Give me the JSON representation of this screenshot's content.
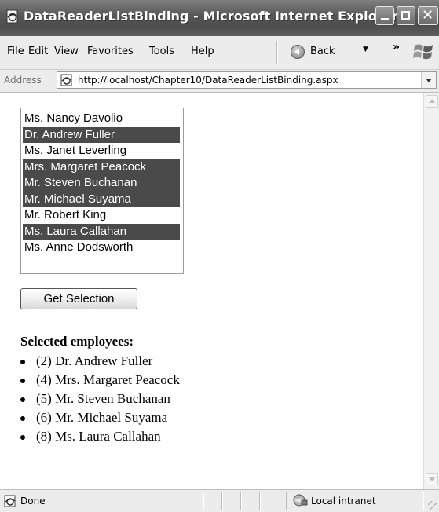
{
  "window": {
    "title": "DataReaderListBinding - Microsoft Internet Explorer"
  },
  "menu": {
    "items": [
      "File",
      "Edit",
      "View",
      "Favorites",
      "Tools",
      "Help"
    ],
    "back_label": "Back",
    "overflow": "»"
  },
  "address": {
    "label": "Address",
    "url": "http://localhost/Chapter10/DataReaderListBinding.aspx"
  },
  "listbox": {
    "items": [
      {
        "label": "Ms. Nancy Davolio",
        "selected": false
      },
      {
        "label": "Dr. Andrew Fuller",
        "selected": true
      },
      {
        "label": "Ms. Janet Leverling",
        "selected": false
      },
      {
        "label": "Mrs. Margaret Peacock",
        "selected": true
      },
      {
        "label": "Mr. Steven Buchanan",
        "selected": true
      },
      {
        "label": "Mr. Michael Suyama",
        "selected": true
      },
      {
        "label": "Mr. Robert King",
        "selected": false
      },
      {
        "label": "Ms. Laura Callahan",
        "selected": true
      },
      {
        "label": "Ms. Anne Dodsworth",
        "selected": false
      }
    ]
  },
  "button": {
    "label": "Get Selection"
  },
  "results": {
    "heading": "Selected employees:",
    "items": [
      "(2) Dr. Andrew Fuller",
      "(4) Mrs. Margaret Peacock",
      "(5) Mr. Steven Buchanan",
      "(6) Mr. Michael Suyama",
      "(8) Ms. Laura Callahan"
    ]
  },
  "status": {
    "text": "Done",
    "zone": "Local intranet"
  },
  "colors": {
    "selection": "#4a4a4a",
    "titlebar": "#5a5a5a"
  }
}
